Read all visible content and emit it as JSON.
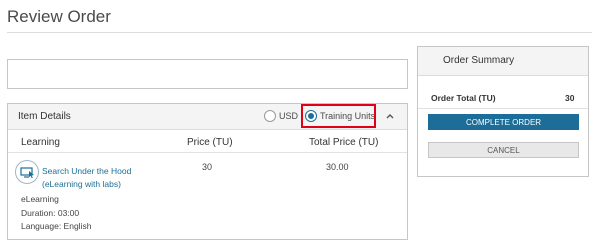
{
  "page": {
    "title": "Review Order"
  },
  "item_details": {
    "title": "Item Details",
    "currency_options": [
      {
        "label": "USD",
        "selected": false
      },
      {
        "label": "Training Units",
        "selected": true
      }
    ],
    "highlight_color": "#e0001a",
    "columns": [
      "Learning",
      "Price (TU)",
      "Total Price (TU)"
    ],
    "items": [
      {
        "title_line1": "Search Under the Hood",
        "title_line2": "(eLearning with labs)",
        "type": "eLearning",
        "duration": "Duration: 03:00",
        "language": "Language: English",
        "price": "30",
        "total_price": "30.00",
        "icon": "monitor-cursor-icon"
      }
    ]
  },
  "order_summary": {
    "title": "Order Summary",
    "total_label": "Order Total (TU)",
    "total_value": "30",
    "complete_label": "COMPLETE ORDER",
    "cancel_label": "CANCEL"
  },
  "colors": {
    "accent": "#1c6e98",
    "highlight": "#e0001a"
  }
}
